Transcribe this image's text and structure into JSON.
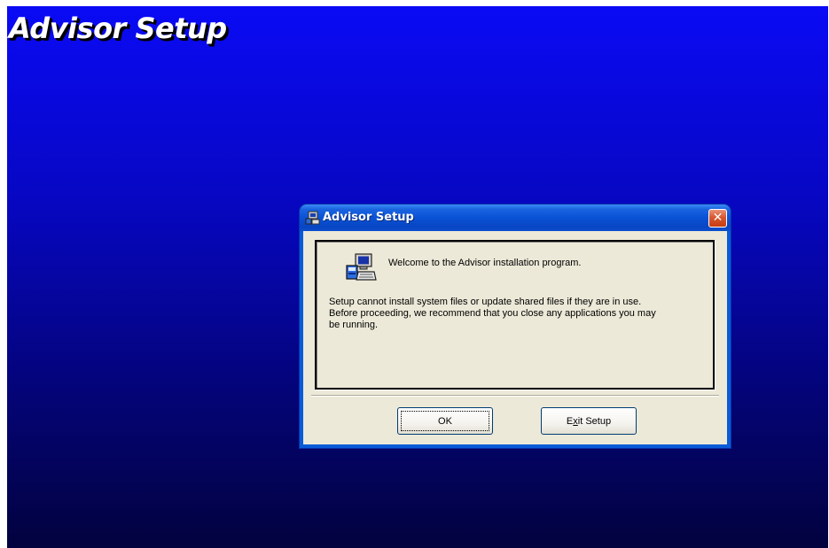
{
  "background": {
    "title": "Advisor Setup"
  },
  "dialog": {
    "title": "Advisor Setup",
    "close_label": "✕",
    "welcome_text": "Welcome to the Advisor installation program.",
    "message_line1": "Setup cannot install system files or update shared files if they are in use.",
    "message_line2": "Before proceeding, we recommend that you close any applications you may",
    "message_line3": "be running.",
    "buttons": {
      "ok_label": "OK",
      "exit_prefix": "E",
      "exit_mnemonic": "x",
      "exit_suffix": "it Setup"
    }
  },
  "colors": {
    "background_top": "#0a0af5",
    "background_bottom": "#02023e",
    "titlebar": "#0a52d6",
    "client": "#ece9d8",
    "close_button": "#d9572f"
  },
  "icons": [
    "setup-window-icon",
    "computer-setup-icon",
    "close-icon"
  ]
}
